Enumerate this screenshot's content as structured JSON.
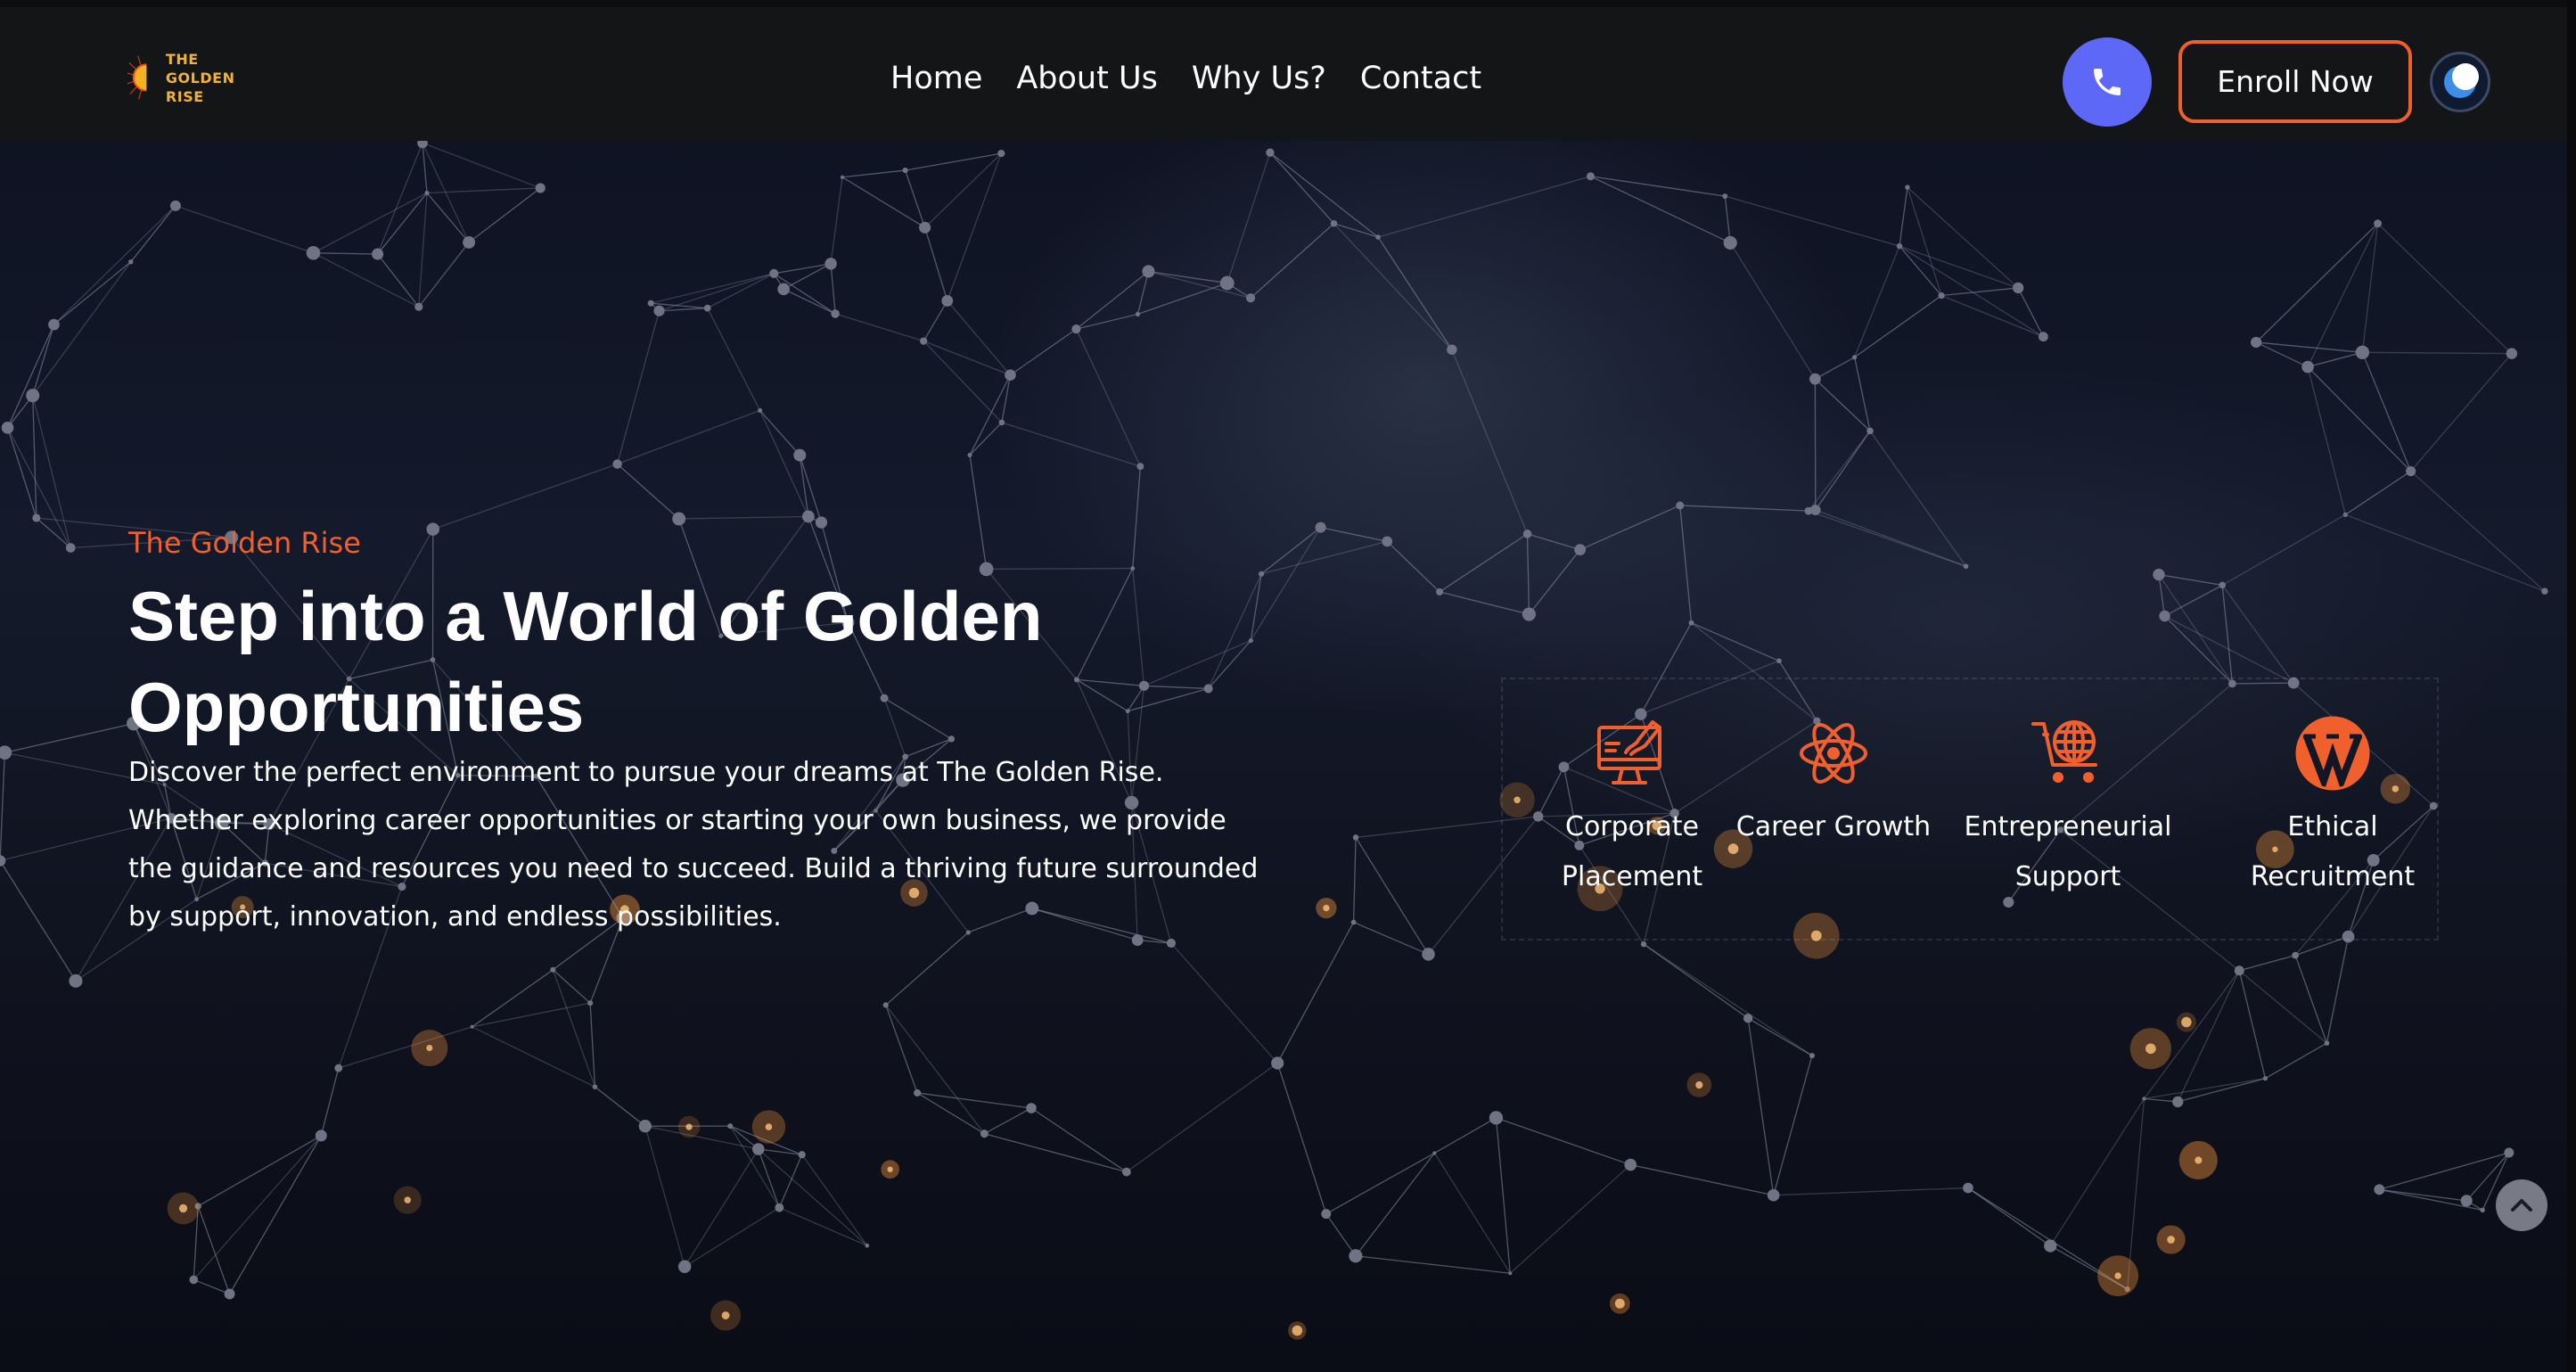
{
  "header": {
    "logo": {
      "line1": "THE GOLDEN",
      "line2": "RISE"
    },
    "nav": [
      {
        "label": "Home"
      },
      {
        "label": "About Us"
      },
      {
        "label": "Why Us?"
      },
      {
        "label": "Contact"
      }
    ],
    "phone_icon": "phone-icon",
    "enroll_label": "Enroll Now",
    "theme_icon": "moon-icon"
  },
  "hero": {
    "eyebrow": "The Golden Rise",
    "title": "Step into a World of Golden Opportunities",
    "description": "Discover the perfect environment to pursue your dreams at The Golden Rise. Whether exploring career opportunities or starting your own business, we provide the guidance and resources you need to succeed. Build a thriving future surrounded by support, innovation, and endless possibilities."
  },
  "features": [
    {
      "icon": "monitor-design-icon",
      "label": "Corporate Placement"
    },
    {
      "icon": "atom-icon",
      "label": "Career Growth"
    },
    {
      "icon": "globe-cart-icon",
      "label": "Entrepreneurial Support"
    },
    {
      "icon": "wordpress-icon",
      "label": "Ethical Recruitment"
    }
  ],
  "scroll_top_icon": "chevron-up-icon",
  "colors": {
    "accent": "#f0602d",
    "phone_button": "#5d68f6",
    "header_bg": "#141516",
    "logo_gold": "#f2b233"
  }
}
